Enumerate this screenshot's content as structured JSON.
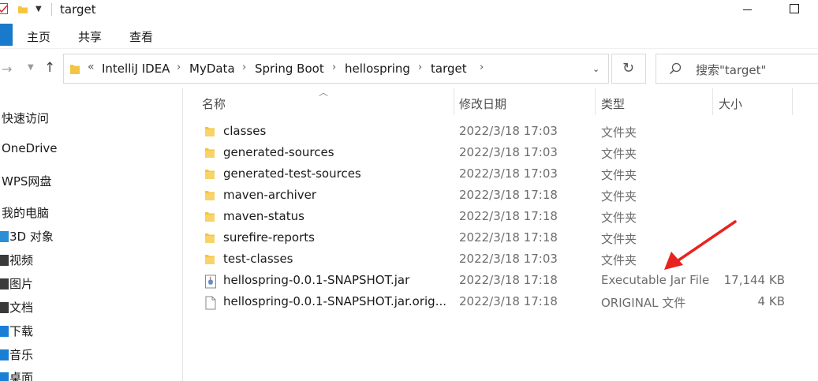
{
  "window": {
    "title": "target"
  },
  "ribbon": {
    "tabs": [
      "主页",
      "共享",
      "查看"
    ]
  },
  "address": {
    "overflow": "«",
    "crumbs": [
      "IntelliJ IDEA",
      "MyData",
      "Spring Boot",
      "hellospring",
      "target"
    ],
    "separator": "›"
  },
  "search": {
    "placeholder": "搜索\"target\""
  },
  "sidebar": {
    "top_items": [
      "快速访问",
      "OneDrive",
      "WPS网盘",
      "我的电脑"
    ],
    "sub_items": [
      {
        "label": "3D 对象",
        "icon": "3d-objects-icon",
        "color": "#2a8fd6"
      },
      {
        "label": "视频",
        "icon": "videos-icon",
        "color": "#3a3a3a"
      },
      {
        "label": "图片",
        "icon": "pictures-icon",
        "color": "#3a3a3a"
      },
      {
        "label": "文档",
        "icon": "documents-icon",
        "color": "#3a3a3a"
      },
      {
        "label": "下载",
        "icon": "downloads-icon",
        "color": "#1a7fd4"
      },
      {
        "label": "音乐",
        "icon": "music-icon",
        "color": "#1a7fd4"
      },
      {
        "label": "桌面",
        "icon": "desktop-icon",
        "color": "#1a7fd4"
      }
    ]
  },
  "columns": {
    "name": "名称",
    "date": "修改日期",
    "type": "类型",
    "size": "大小"
  },
  "files": [
    {
      "name": "classes",
      "date": "2022/3/18 17:03",
      "type": "文件夹",
      "size": "",
      "icon": "folder-icon"
    },
    {
      "name": "generated-sources",
      "date": "2022/3/18 17:03",
      "type": "文件夹",
      "size": "",
      "icon": "folder-icon"
    },
    {
      "name": "generated-test-sources",
      "date": "2022/3/18 17:03",
      "type": "文件夹",
      "size": "",
      "icon": "folder-icon"
    },
    {
      "name": "maven-archiver",
      "date": "2022/3/18 17:18",
      "type": "文件夹",
      "size": "",
      "icon": "folder-icon"
    },
    {
      "name": "maven-status",
      "date": "2022/3/18 17:18",
      "type": "文件夹",
      "size": "",
      "icon": "folder-icon"
    },
    {
      "name": "surefire-reports",
      "date": "2022/3/18 17:18",
      "type": "文件夹",
      "size": "",
      "icon": "folder-icon"
    },
    {
      "name": "test-classes",
      "date": "2022/3/18 17:03",
      "type": "文件夹",
      "size": "",
      "icon": "folder-icon"
    },
    {
      "name": "hellospring-0.0.1-SNAPSHOT.jar",
      "date": "2022/3/18 17:18",
      "type": "Executable Jar File",
      "size": "17,144 KB",
      "icon": "jar-file-icon"
    },
    {
      "name": "hellospring-0.0.1-SNAPSHOT.jar.orig...",
      "date": "2022/3/18 17:18",
      "type": "ORIGINAL 文件",
      "size": "4 KB",
      "icon": "blank-file-icon"
    }
  ],
  "annotation": {
    "arrow_color": "#e8231f"
  },
  "colors": {
    "folder": "#f4c542",
    "accent": "#1979ca"
  }
}
